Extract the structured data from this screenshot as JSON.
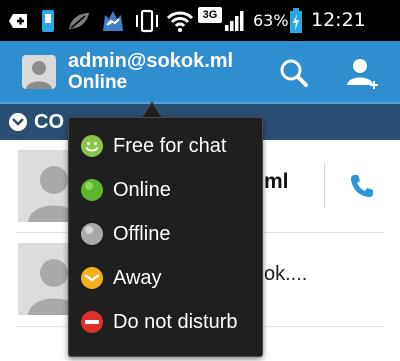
{
  "status_bar": {
    "battery_percent": "63%",
    "time": "12:21 AM",
    "network": "3G",
    "icons": [
      "add-icon",
      "sim-card-icon",
      "leaf-icon",
      "wolf-icon",
      "vibrate-icon",
      "wifi-icon",
      "network-3g-icon",
      "signal-icon",
      "battery-charging-icon"
    ]
  },
  "account": {
    "name": "admin@sokok.ml",
    "status": "Online",
    "icons": [
      "avatar-icon",
      "search-icon",
      "add-contact-icon"
    ]
  },
  "group": {
    "label": "CO"
  },
  "contacts": [
    {
      "name_visible": "ml",
      "call_icon": "phone-icon"
    },
    {
      "subtitle_visible": "ok...."
    }
  ],
  "status_menu": {
    "items": [
      {
        "label": "Free for chat",
        "icon": "smiley-icon",
        "color": "#8bc34a"
      },
      {
        "label": "Online",
        "icon": "online-dot-icon",
        "color": "#5cb82a"
      },
      {
        "label": "Offline",
        "icon": "offline-dot-icon",
        "color": "#a9a9a9"
      },
      {
        "label": "Away",
        "icon": "away-icon",
        "color": "#f2b21b"
      },
      {
        "label": "Do not disturb",
        "icon": "do-not-disturb-icon",
        "color": "#e0302a"
      }
    ]
  },
  "colors": {
    "action_bar": "#2f8ecf",
    "group_header": "#2b4f72",
    "popup_bg": "#1f1f1f",
    "status_bar": "#000000"
  }
}
